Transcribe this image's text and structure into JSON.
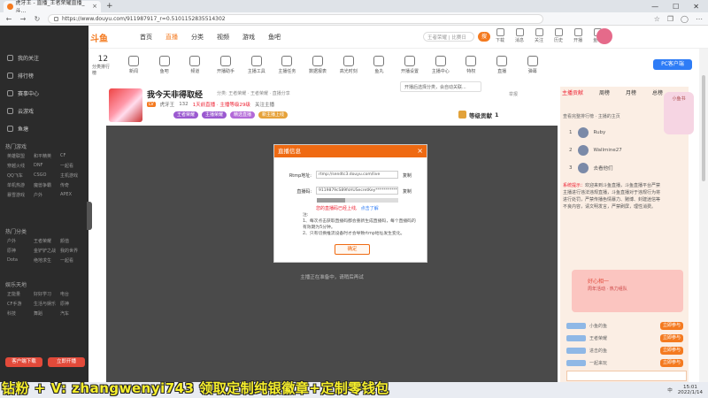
{
  "browser": {
    "tab_title": "虎牙王 - 直播_王者荣耀直播_斗...",
    "url": "https://www.douyu.com/911987917_r=0.5101152835514302",
    "nav": {
      "back": "←",
      "forward": "→",
      "refresh": "↻"
    },
    "window": {
      "minimize": "—",
      "maximize": "☐",
      "close": "✕"
    }
  },
  "site": {
    "logo": "斗鱼",
    "nav": [
      "首页",
      "直播",
      "分类",
      "视频",
      "游戏",
      "鱼吧"
    ],
    "active_nav": "直播",
    "search_placeholder": "王者荣耀 | 比赛日",
    "search_btn": "搜",
    "header_icons": [
      "下载",
      "消息",
      "关注",
      "历史",
      "开播",
      "鱼塘"
    ]
  },
  "sidebar": {
    "items": [
      "我的关注",
      "排行榜",
      "赛事中心",
      "云游戏",
      "鱼塘"
    ],
    "section_hot": "热门游戏",
    "section_more": "热门分类",
    "section_entertain": "娱乐天地",
    "grid1": [
      "英雄联盟",
      "和平精英",
      "CF",
      "穿越火线",
      "DNF",
      "一起看",
      "QQ飞车",
      "CSGO",
      "主机游戏",
      "单机热游",
      "魔兽争霸",
      "传奇",
      "暴雪游戏",
      "户外",
      "APEX"
    ],
    "grid2": [
      "户外",
      "王者荣耀",
      "颜值",
      "原神",
      "金铲铲之战",
      "我的世界",
      "Dota",
      "绝地求生",
      "一起看"
    ],
    "grid3": [
      "正能量",
      "好好学习",
      "电台",
      "CF手游",
      "生活与娱乐",
      "原神",
      "科技",
      "舞蹈",
      "汽车"
    ],
    "btn_left": "客户端下载",
    "btn_right": "立即开播"
  },
  "categories": {
    "count": "12",
    "count_label": "分类排行榜",
    "items": [
      "新闻",
      "鱼吧",
      "频道",
      "开播助手",
      "主播工具",
      "主播任务",
      "数据报表",
      "高光时刻",
      "鱼丸",
      "开播设置",
      "主播中心",
      "特权",
      "直播",
      "弹幕",
      "主播等级",
      "小工具箱"
    ]
  },
  "dropdown_text": "开播后选择分类，会自动关联...",
  "pc_button": "PC客户端",
  "room": {
    "title": "我今天非得取经",
    "subtitle": "分类: 王者荣耀 · 王者荣耀 · 直播分享",
    "level_badge": "LV",
    "anchor_name": "虎牙王",
    "fans": "132",
    "hot_text": "1天前直播 · 主播等级29级",
    "views": "关注主播",
    "tags": [
      "王者荣耀",
      "主播荣耀",
      "精选直播",
      "新主播上线"
    ],
    "report": "举报",
    "ranking_label": "等级贡献",
    "ranking_num": "1"
  },
  "modal": {
    "title": "直播信息",
    "close": "×",
    "rtmp_label": "Rtmp地址:",
    "rtmp_value": "rtmp://sendtc3.douyu.com/live",
    "copy_label": "复制",
    "key_label": "直播码:",
    "key_value": "9119879cS89fsHUSecretKey*************",
    "progress_pct": 35,
    "warn": "您的直播码已经上线,",
    "warn_link": "点击了解",
    "notes": [
      "注:",
      "1、每次点击获取直播码都会重新生成直播码，每个直播码的有效期为5分钟。",
      "2、只有切换推流设备时才会导致rtmp地址发生变化。"
    ],
    "confirm": "确定"
  },
  "video_hint": "主播正在准备中，请稍后再试",
  "rightpanel": {
    "tabs": [
      "主播贡献",
      "周榜",
      "月榜",
      "总榜"
    ],
    "active_tab": "主播贡献",
    "sub": "查看完整排行榜 · 主播的主页",
    "fans": [
      {
        "name": "Ruby",
        "rank": "1"
      },
      {
        "name": "Wallmine27",
        "rank": "2"
      },
      {
        "name": "去看他们",
        "rank": "3"
      }
    ],
    "notice_title": "系统提示：",
    "notice": "欢迎来到斗鱼直播，斗鱼直播平台严禁主播进行违法违规直播，斗鱼直播对于违规行为将进行处罚，严禁传播色情暴力、赌博、封建迷信等不良内容，请文明发言，严禁刷屏，理性消费。",
    "mascot_label": "小鱼书",
    "card_title": "好心相一",
    "card_sub": "周年活动 · 热力组队",
    "list": [
      {
        "name": "小鱼的鱼",
        "btn": "立即参与"
      },
      {
        "name": "王者荣耀",
        "btn": "立即参与"
      },
      {
        "name": "进击的鱼",
        "btn": "立即参与"
      },
      {
        "name": "一起来玩",
        "btn": "立即参与"
      }
    ]
  },
  "overlay": "钻粉 + V: zhangwenyi743 领取定制纯银徽章+定制零钱包",
  "tray": {
    "time": "15:01",
    "date": "2022/1/14",
    "ime": "中"
  }
}
